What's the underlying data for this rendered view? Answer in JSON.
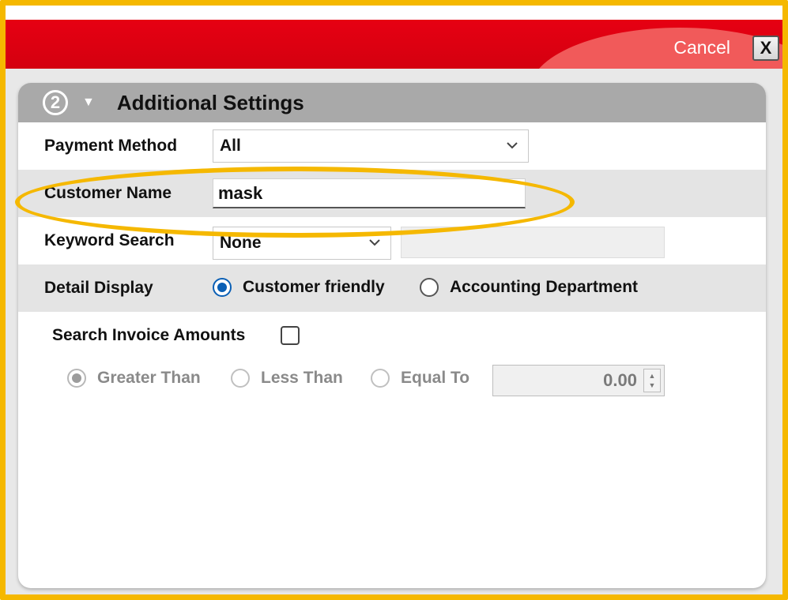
{
  "header": {
    "cancel_label": "Cancel",
    "close_label": "X"
  },
  "panel": {
    "step": "2",
    "title": "Additional Settings"
  },
  "payment_method": {
    "label": "Payment Method",
    "value": "All"
  },
  "customer_name": {
    "label": "Customer Name",
    "value": "mask"
  },
  "keyword_search": {
    "label": "Keyword Search",
    "value": "None",
    "text_value": ""
  },
  "detail_display": {
    "label": "Detail Display",
    "options": [
      "Customer friendly",
      "Accounting Department"
    ],
    "selected": "Customer friendly"
  },
  "search_invoice": {
    "label": "Search Invoice Amounts",
    "checked": false,
    "comparisons": [
      "Greater Than",
      "Less Than",
      "Equal To"
    ],
    "selected_comparison": "Greater Than",
    "amount": "0.00"
  },
  "colors": {
    "header_red": "#e60012",
    "highlight": "#f5b800",
    "radio_selected": "#0a5fb5"
  }
}
